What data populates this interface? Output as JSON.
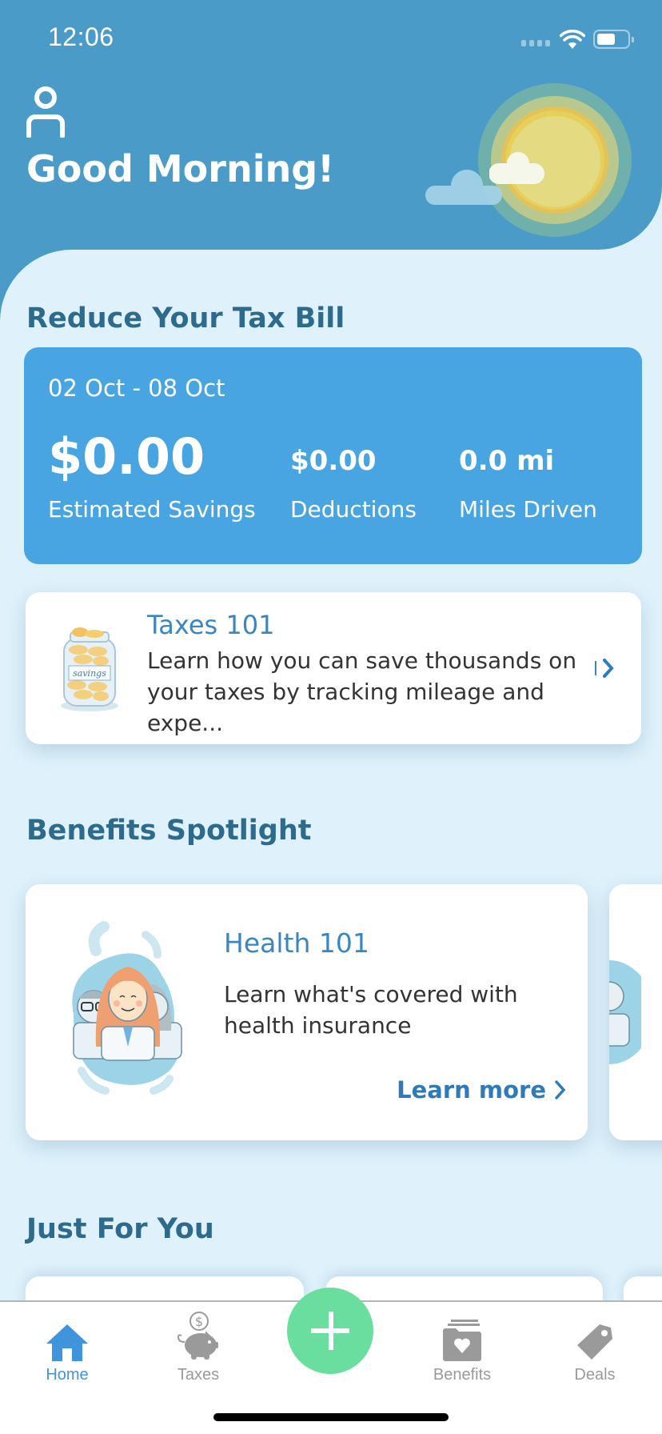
{
  "status_bar": {
    "time": "12:06",
    "icons": [
      "cellular-signal-icon",
      "wifi-icon",
      "battery-icon"
    ]
  },
  "header": {
    "greeting": "Good Morning!",
    "profile_icon": "person-icon",
    "illustration": "sun-and-clouds"
  },
  "tax_section": {
    "title": "Reduce Your Tax Bill",
    "summary": {
      "date_range": "02 Oct - 08 Oct",
      "estimated_savings_value": "$0.00",
      "estimated_savings_label": "Estimated Savings",
      "deductions_value": "$0.00",
      "deductions_label": "Deductions",
      "miles_value": "0.0 mi",
      "miles_label": "Miles Driven"
    },
    "taxes_101": {
      "title": "Taxes 101",
      "description": "Learn how you can save thousands on your taxes by tracking mileage and expe...",
      "jar_label": "savings"
    }
  },
  "benefits_section": {
    "title": "Benefits Spotlight",
    "cards": [
      {
        "title": "Health 101",
        "description": "Learn what's covered with health insurance",
        "link": "Learn more"
      }
    ]
  },
  "just_for_you": {
    "title": "Just For You"
  },
  "tab_bar": {
    "tabs": [
      {
        "label": "Home",
        "icon": "home-icon",
        "active": true
      },
      {
        "label": "Taxes",
        "icon": "piggy-bank-icon",
        "active": false
      },
      {
        "label": "Benefits",
        "icon": "folder-heart-icon",
        "active": false
      },
      {
        "label": "Deals",
        "icon": "tag-icon",
        "active": false
      }
    ],
    "fab_icon": "plus-icon"
  },
  "colors": {
    "header": "#4a9bc8",
    "background": "#dff2fc",
    "savings_card": "#48a5e2",
    "section_title": "#2d6a8b",
    "card_title": "#3a86c0",
    "active_tab": "#3f94dc",
    "fab": "#69de9e"
  }
}
